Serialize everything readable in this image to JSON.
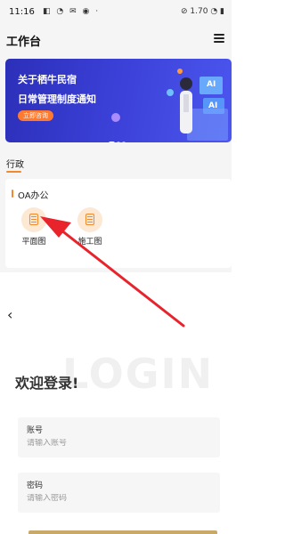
{
  "status_bar": {
    "time": "11:16",
    "icons": "◧ ◔ ✉ ◉ ·",
    "right": "⊘ 1.70 ◔ ▮"
  },
  "header": {
    "title": "工作台"
  },
  "banner": {
    "line1": "关于栖牛民宿",
    "line2": "日常管理制度通知",
    "button": "立即咨询",
    "badge1": "AI",
    "badge2": "AI"
  },
  "tab": {
    "label": "行政"
  },
  "section": {
    "title": "OA办公",
    "apps": [
      {
        "label": "平面图"
      },
      {
        "label": "施工图"
      }
    ]
  },
  "login": {
    "back": "‹",
    "ghost_text": "LOGIN",
    "welcome": "欢迎登录!",
    "account": {
      "label": "账号",
      "placeholder": "请输入账号"
    },
    "password": {
      "label": "密码",
      "placeholder": "请输入密码"
    }
  },
  "colors": {
    "accent": "#f08a2c",
    "banner": "#3a3fd6",
    "arrow": "#e8232b"
  }
}
